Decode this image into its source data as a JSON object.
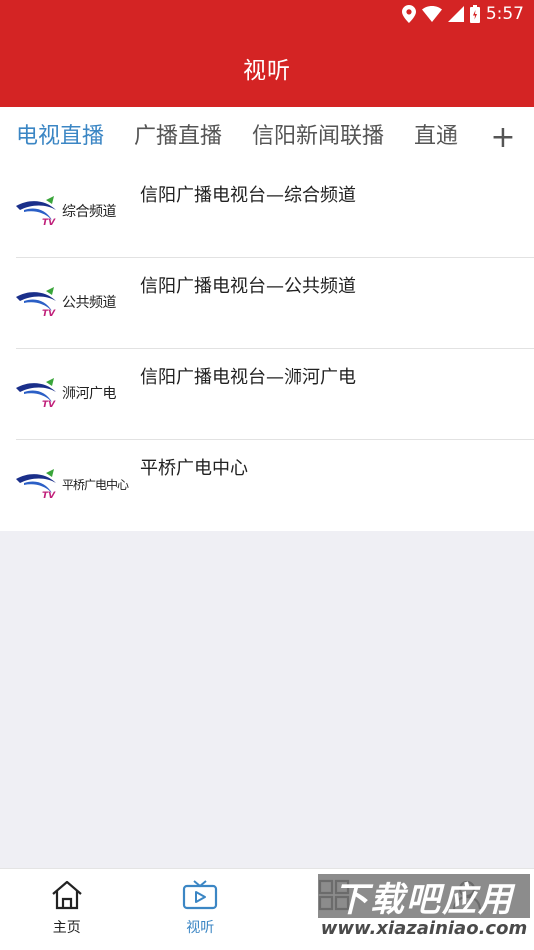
{
  "status_bar": {
    "time": "5:57",
    "icons": [
      "location-icon",
      "wifi-icon",
      "signal-icon",
      "battery-icon"
    ]
  },
  "app_bar": {
    "title": "视听"
  },
  "tabs": {
    "items": [
      {
        "label": "电视直播",
        "active": true
      },
      {
        "label": "广播直播",
        "active": false
      },
      {
        "label": "信阳新闻联播",
        "active": false
      },
      {
        "label": "直通",
        "active": false
      }
    ],
    "add_label": "+"
  },
  "channels": [
    {
      "logo_text": "综合频道",
      "title": "信阳广播电视台—综合频道"
    },
    {
      "logo_text": "公共频道",
      "title": "信阳广播电视台—公共频道"
    },
    {
      "logo_text": "浉河广电",
      "title": "信阳广播电视台—浉河广电"
    },
    {
      "logo_text": "平桥广电中心",
      "title": "平桥广电中心"
    }
  ],
  "bottom_nav": [
    {
      "label": "主页",
      "icon": "home-icon",
      "active": false
    },
    {
      "label": "视听",
      "icon": "tv-icon",
      "active": true
    },
    {
      "label": "",
      "icon": "grid-icon",
      "active": false
    },
    {
      "label": "",
      "icon": "user-icon",
      "active": false
    }
  ],
  "watermark": {
    "top": "下载吧应用",
    "bottom": "www.xiazainiao.com"
  },
  "colors": {
    "primary_red": "#d42424",
    "active_blue": "#3b86c4",
    "background": "#efeff4"
  }
}
